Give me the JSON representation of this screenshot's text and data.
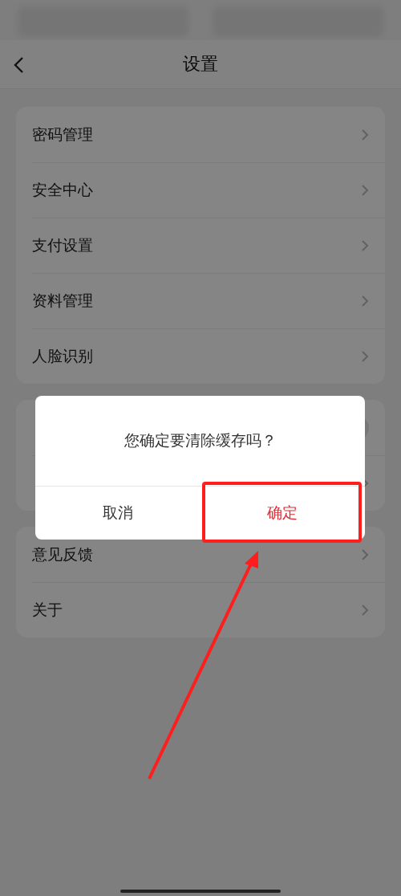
{
  "header": {
    "title": "设置"
  },
  "groups": [
    {
      "items": [
        {
          "label": "密码管理"
        },
        {
          "label": "安全中心"
        },
        {
          "label": "支付设置"
        },
        {
          "label": "资料管理"
        },
        {
          "label": "人脸识别"
        }
      ]
    },
    {
      "items": [
        {
          "label": "意见反馈"
        },
        {
          "label": "关于"
        }
      ]
    }
  ],
  "covered_card": {
    "toggle": {
      "on": false
    }
  },
  "dialog": {
    "message": "您确定要清除缓存吗？",
    "buttons": [
      {
        "label": "取消",
        "kind": "cancel",
        "highlighted": false
      },
      {
        "label": "确定",
        "kind": "confirm",
        "highlighted": true
      }
    ]
  }
}
